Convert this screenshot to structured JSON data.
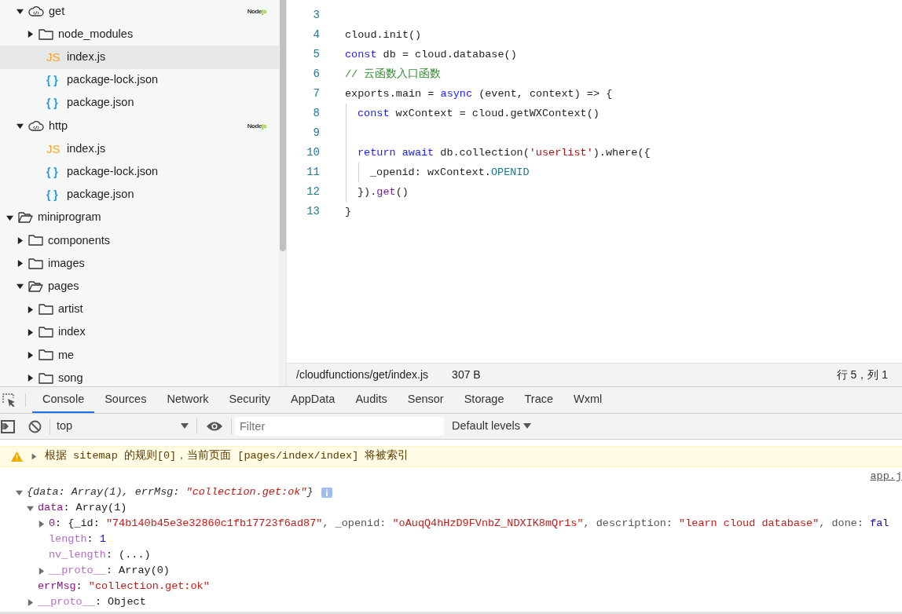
{
  "sidebar": {
    "tree": [
      {
        "kind": "cut-off",
        "children": [
          {
            "kind": "cloud",
            "label": "get",
            "expanded": true,
            "selected": false,
            "badge": {
              "text": "Node",
              "accent": "js"
            },
            "children": [
              {
                "kind": "folder",
                "label": "node_modules",
                "expanded": false,
                "selected": false
              },
              {
                "kind": "js",
                "icon": "JS",
                "label": "index.js",
                "selected": true
              },
              {
                "kind": "json",
                "icon": "{ }",
                "label": "package-lock.json",
                "selected": false
              },
              {
                "kind": "json",
                "icon": "{ }",
                "label": "package.json",
                "selected": false
              }
            ]
          },
          {
            "kind": "cloud",
            "label": "http",
            "expanded": true,
            "selected": false,
            "badge": {
              "text": "Node",
              "accent": "js"
            },
            "children": [
              {
                "kind": "js",
                "icon": "JS",
                "label": "index.js",
                "selected": false
              },
              {
                "kind": "json",
                "icon": "{ }",
                "label": "package-lock.json",
                "selected": false
              },
              {
                "kind": "json",
                "icon": "{ }",
                "label": "package.json",
                "selected": false
              }
            ]
          }
        ]
      },
      {
        "kind": "folder",
        "label": "miniprogram",
        "expanded": true,
        "selected": false,
        "children": [
          {
            "kind": "folder",
            "label": "components",
            "expanded": false,
            "selected": false
          },
          {
            "kind": "folder",
            "label": "images",
            "expanded": false,
            "selected": false
          },
          {
            "kind": "folder",
            "label": "pages",
            "expanded": true,
            "selected": false,
            "children": [
              {
                "kind": "folder",
                "label": "artist",
                "expanded": false,
                "selected": false
              },
              {
                "kind": "folder",
                "label": "index",
                "expanded": false,
                "selected": false
              },
              {
                "kind": "folder",
                "label": "me",
                "expanded": false,
                "selected": false
              },
              {
                "kind": "folder",
                "label": "song",
                "expanded": false,
                "selected": false
              }
            ]
          }
        ]
      }
    ]
  },
  "editor": {
    "lines": [
      {
        "number": "3"
      },
      {
        "number": "4",
        "tokens": [
          {
            "text": "cloud.init()",
            "kind": "plain"
          }
        ]
      },
      {
        "number": "5",
        "tokens": [
          {
            "text": "const",
            "kind": "keyword"
          },
          {
            "text": " db = cloud.database()",
            "kind": "plain"
          }
        ]
      },
      {
        "number": "6",
        "tokens": [
          {
            "text": "// 云函数入口函数",
            "kind": "comment"
          }
        ]
      },
      {
        "number": "7",
        "tokens": [
          {
            "text": "exports.main = ",
            "kind": "plain"
          },
          {
            "text": "async",
            "kind": "keyword"
          },
          {
            "text": " (event, context) => {",
            "kind": "plain"
          }
        ]
      },
      {
        "number": "8",
        "kind": "block",
        "tokens": [
          {
            "text": "const",
            "kind": "keyword"
          },
          {
            "text": " wxContext = cloud.getWXContext()",
            "kind": "plain"
          }
        ]
      },
      {
        "number": "9",
        "kind": "block"
      },
      {
        "number": "10",
        "kind": "block",
        "tokens": [
          {
            "text": "return await",
            "kind": "keyword"
          },
          {
            "text": " db.collection(",
            "kind": "plain"
          },
          {
            "text": "'userlist'",
            "kind": "string"
          },
          {
            "text": ").where({",
            "kind": "plain"
          }
        ]
      },
      {
        "number": "11",
        "kind": "inner",
        "tokens": [
          {
            "text": "_openid: wxContext.",
            "kind": "plain"
          },
          {
            "text": "OPENID",
            "kind": "constant"
          }
        ]
      },
      {
        "number": "12",
        "kind": "block",
        "tokens": [
          {
            "text": "}).",
            "kind": "plain"
          },
          {
            "text": "get",
            "kind": "method"
          },
          {
            "text": "()",
            "kind": "plain"
          }
        ]
      },
      {
        "number": "13",
        "tokens": [
          {
            "text": "}",
            "kind": "plain"
          }
        ]
      }
    ]
  },
  "status_bar": {
    "path": "/cloudfunctions/get/index.js",
    "size": "307 B",
    "cursor": "行 5，列 1"
  },
  "devtools": {
    "tabs": [
      {
        "label": "Console",
        "selected": true
      },
      {
        "label": "Sources",
        "selected": false
      },
      {
        "label": "Network",
        "selected": false
      },
      {
        "label": "Security",
        "selected": false
      },
      {
        "label": "AppData",
        "selected": false
      },
      {
        "label": "Audits",
        "selected": false
      },
      {
        "label": "Sensor",
        "selected": false
      },
      {
        "label": "Storage",
        "selected": false
      },
      {
        "label": "Trace",
        "selected": false
      },
      {
        "label": "Wxml",
        "selected": false
      }
    ],
    "context": "top",
    "filter": {
      "placeholder": "Filter"
    },
    "levels": "Default levels",
    "warning": {
      "text": "根据 sitemap 的规则[0]，当前页面 [pages/index/index] 将被索引",
      "expanded": false
    },
    "log": {
      "source": "app.j",
      "tree": [
        {
          "expanded": true,
          "info": true,
          "tokens": [
            {
              "text": "{data: Array(1), errMsg: ",
              "kind": "italic"
            },
            {
              "text": "\"collection.get:ok\"",
              "kind": "italic-string"
            },
            {
              "text": "}",
              "kind": "italic"
            }
          ],
          "children": [
            {
              "expanded": true,
              "tokens": [
                {
                  "text": "data",
                  "kind": "key"
                },
                {
                  "text": ": Array(1)",
                  "kind": "plain"
                }
              ],
              "children": [
                {
                  "expanded": false,
                  "tokens": [
                    {
                      "text": "0",
                      "kind": "key"
                    },
                    {
                      "text": ": {_id: ",
                      "kind": "plain"
                    },
                    {
                      "text": "\"74b140b45e3e32860c1fb17723f6ad87\"",
                      "kind": "string"
                    },
                    {
                      "text": ", _openid: ",
                      "kind": "dim"
                    },
                    {
                      "text": "\"oAuqQ4hHzD9FVnbZ_NDXIK8mQr1s\"",
                      "kind": "string"
                    },
                    {
                      "text": ", description: ",
                      "kind": "dim"
                    },
                    {
                      "text": "\"learn cloud database\"",
                      "kind": "string"
                    },
                    {
                      "text": ", done: ",
                      "kind": "dim"
                    },
                    {
                      "text": "fal",
                      "kind": "number"
                    }
                  ]
                },
                {
                  "tokens": [
                    {
                      "text": "length",
                      "kind": "key-dim"
                    },
                    {
                      "text": ": ",
                      "kind": "plain"
                    },
                    {
                      "text": "1",
                      "kind": "number"
                    }
                  ]
                },
                {
                  "tokens": [
                    {
                      "text": "nv_length",
                      "kind": "key-dim"
                    },
                    {
                      "text": ": (...)",
                      "kind": "plain"
                    }
                  ]
                },
                {
                  "expanded": false,
                  "tokens": [
                    {
                      "text": "__proto__",
                      "kind": "key-dim"
                    },
                    {
                      "text": ": Array(0)",
                      "kind": "plain"
                    }
                  ]
                }
              ]
            },
            {
              "tokens": [
                {
                  "text": "errMsg",
                  "kind": "key"
                },
                {
                  "text": ": ",
                  "kind": "plain"
                },
                {
                  "text": "\"collection.get:ok\"",
                  "kind": "string"
                }
              ]
            },
            {
              "expanded": false,
              "tokens": [
                {
                  "text": "__proto__",
                  "kind": "key-dim"
                },
                {
                  "text": ": Object",
                  "kind": "plain"
                }
              ]
            }
          ]
        }
      ]
    }
  }
}
